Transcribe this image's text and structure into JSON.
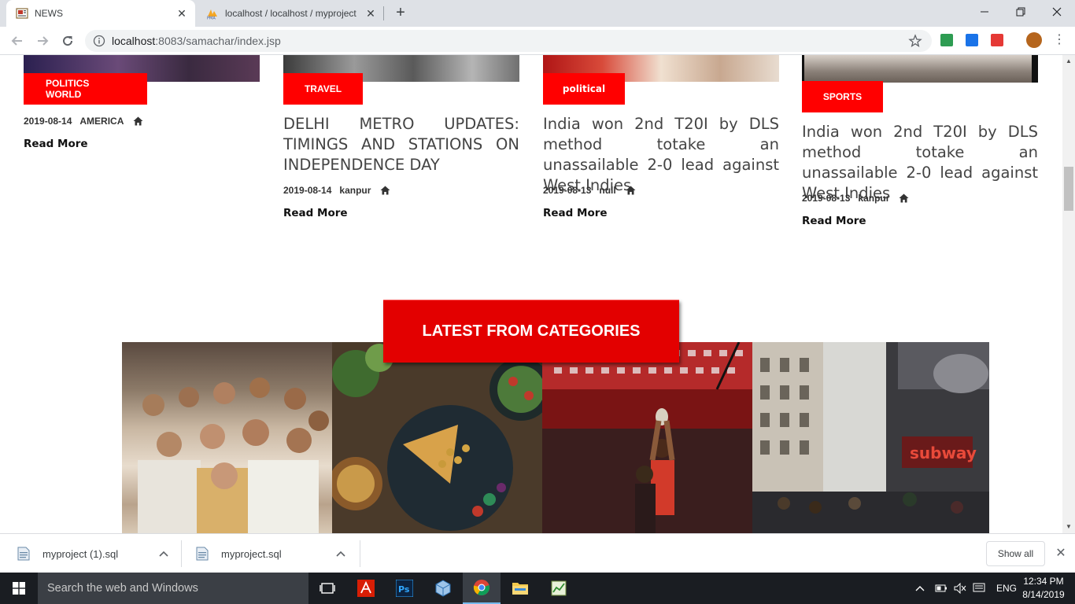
{
  "browser": {
    "tabs": [
      {
        "title": "NEWS",
        "active": true
      },
      {
        "title": "localhost / localhost / myproject",
        "active": false
      }
    ],
    "url_host": "localhost",
    "url_rest": ":8083/samachar/index.jsp"
  },
  "cards": [
    {
      "category": "POLITICS WORLD",
      "date": "2019-08-14",
      "location": "AMERICA",
      "headline": "",
      "read_more": "Read More"
    },
    {
      "category": "TRAVEL",
      "date": "2019-08-14",
      "location": "kanpur",
      "headline": "DELHI METRO UPDATES: TIMINGS AND STATIONS ON INDEPENDENCE DAY",
      "read_more": "Read More"
    },
    {
      "category": "political",
      "date": "2019-08-13",
      "location": "null",
      "headline": "India won 2nd T20I by DLS method totake an unassailable 2-0 lead against West Indies",
      "read_more": "Read More"
    },
    {
      "category": "SPORTS",
      "date": "2019-08-13",
      "location": "kanpur",
      "headline": "India won 2nd T20I by DLS method totake an unassailable 2-0 lead against West Indies",
      "read_more": "Read More"
    }
  ],
  "latest_section": {
    "title": "LATEST FROM CATEGORIES"
  },
  "downloads": {
    "items": [
      {
        "name": "myproject (1).sql"
      },
      {
        "name": "myproject.sql"
      }
    ],
    "show_all": "Show all"
  },
  "taskbar": {
    "search_placeholder": "Search the web and Windows",
    "language": "ENG",
    "time": "12:34 PM",
    "date": "8/14/2019"
  },
  "colors": {
    "accent_red": "#ff0000",
    "latest_red": "#e30000"
  }
}
